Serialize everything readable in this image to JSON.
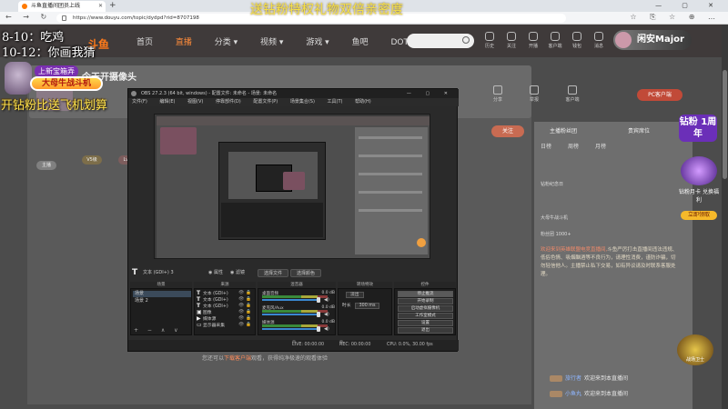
{
  "browser": {
    "tab_title": "斗鱼直播间团员上线",
    "new_tab": "+",
    "window_controls": "— ▢ ✕",
    "nav_icons": "← → ↻ ⌂",
    "url": "https://www.douyu.com/topic/dydpd?rid=8707198",
    "right_icons": "☆ ⎘ ☆ ⊕ …"
  },
  "overlay": {
    "title": "送钻粉特权礼物双倍亲密度",
    "schedule_1": "8-10：吃鸡",
    "schedule_2": "10-12：你画我猜",
    "fight_tag": "上新宝箱弄",
    "fight_button": "大母牛战斗机",
    "promo": "开钻粉比送飞机划算"
  },
  "header": {
    "logo": "斗鱼",
    "nav": [
      "首页",
      "直播",
      "分类 ▾",
      "视频 ▾",
      "游戏 ▾",
      "鱼吧",
      "DOTA2"
    ],
    "icons": [
      "历史",
      "关注",
      "开播",
      "客户端",
      "钱包",
      "消息"
    ],
    "username": "闲安Major"
  },
  "room": {
    "title": "今天开摄像头",
    "pills": [
      "V5级",
      "Lv.",
      "主播"
    ],
    "follow": "关注",
    "pc_button": "PC客户端",
    "top_icons": [
      "分享",
      "举报",
      "客户端"
    ],
    "below_text_pre": "您还可以",
    "below_text_hl": "下载客户端",
    "below_text_post": "观看，获得纯净极速的观看体验"
  },
  "sidebar": {
    "tabs": [
      "主播粉丝团",
      "贵宾席位"
    ],
    "sub_tabs": [
      "日榜",
      "周榜",
      "月榜"
    ],
    "lines": [
      "钻粉纪念日",
      "大母牛战斗机",
      "粉丝团 1000+"
    ],
    "announcement_red": "欢迎来到英雄联盟电竞直播间,",
    "announcement": "斗鱼严厉打击直播间违法违规、低俗色情、吸烟酗酒等不良行为，请理性消费，谨防诈骗，切勿轻信他人。主播禁止私下交易，如有异议请及时联系客服处理。",
    "chat": [
      {
        "user": "旅行者",
        "msg": "欢迎来到本直播间"
      },
      {
        "user": "小鱼丸",
        "msg": "欢迎来到本直播间"
      }
    ]
  },
  "badges": {
    "fan_top": "钻粉 1周年",
    "fan_label": "钻粉月卡 兑换福利",
    "fan_button": "立即领取",
    "guard": "战场卫士"
  },
  "obs": {
    "title": "OBS 27.2.3 (64 bit, windows) - 配置文件: 未命名 - 场景: 未命名",
    "window_controls": "— ▢ ✕",
    "menu": [
      "文件(F)",
      "编辑(E)",
      "视图(V)",
      "停靠部件(D)",
      "配置文件(P)",
      "场景集合(S)",
      "工具(T)",
      "帮助(H)"
    ],
    "source_label": "文本 (GDI+) 3",
    "opt1": "◉ 属性",
    "opt2": "◉ 滤镜",
    "btn1": "选择文件",
    "btn2": "选择颜色",
    "dock_headers": [
      "场景",
      "来源",
      "混音器",
      "转场特效",
      "控件"
    ],
    "scenes": [
      "场景",
      "场景 2"
    ],
    "sources": [
      {
        "name": "文本 (GDI+)",
        "icons": "👁🔒"
      },
      {
        "name": "文本 (GDI+)",
        "icons": "👁🔒"
      },
      {
        "name": "文本 (GDI+)",
        "icons": "👁🔒"
      },
      {
        "name": "图像",
        "icons": "👁🔒"
      },
      {
        "name": "媒体源",
        "icons": "👁🔒"
      },
      {
        "name": "显示器采集",
        "icons": "👁🔒"
      }
    ],
    "mixer": [
      {
        "name": "桌面音频",
        "db": "0.0 dB"
      },
      {
        "name": "麦克风/Aux",
        "db": "0.0 dB"
      },
      {
        "name": "媒体源",
        "db": "0.0 dB"
      }
    ],
    "transition": "淡出",
    "duration_label": "时长",
    "duration": "300 ms",
    "controls": [
      "停止推流",
      "开始录制",
      "启动虚拟摄像机",
      "工作室模式",
      "设置",
      "退出"
    ],
    "foot_icons": "+ − ∧ ∨",
    "status": [
      "LIVE: 00:00:00",
      "REC: 00:00:00",
      "CPU: 0.0%, 30.00 fps"
    ]
  }
}
